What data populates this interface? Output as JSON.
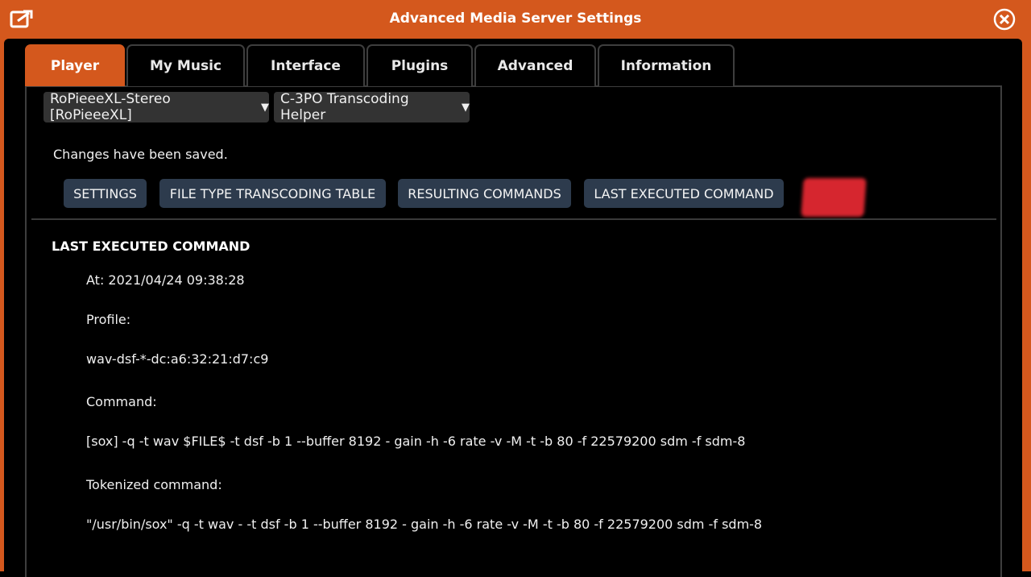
{
  "window": {
    "title": "Advanced Media Server Settings",
    "accent_color": "#d4581d",
    "popout_icon": "popout-icon",
    "close_icon": "close-icon"
  },
  "tabs": [
    {
      "label": "Player",
      "active": true
    },
    {
      "label": "My Music",
      "active": false
    },
    {
      "label": "Interface",
      "active": false
    },
    {
      "label": "Plugins",
      "active": false
    },
    {
      "label": "Advanced",
      "active": false
    },
    {
      "label": "Information",
      "active": false
    }
  ],
  "selectors": {
    "player": "RoPieeeXL-Stereo [RoPieeeXL]",
    "plugin": "C-3PO Transcoding Helper",
    "arrow": "▼"
  },
  "status_message": "Changes have been saved.",
  "subtabs": [
    {
      "label": "SETTINGS"
    },
    {
      "label": "FILE TYPE TRANSCODING TABLE"
    },
    {
      "label": "RESULTING COMMANDS"
    },
    {
      "label": "LAST EXECUTED COMMAND"
    }
  ],
  "last_command": {
    "heading": "LAST EXECUTED COMMAND",
    "at": "At: 2021/04/24 09:38:28",
    "profile_label": "Profile:",
    "profile_value": "wav-dsf-*-dc:a6:32:21:d7:c9",
    "command_label": "Command:",
    "command_value": "[sox] -q -t wav $FILE$ -t dsf -b 1 --buffer 8192 - gain -h -6 rate -v -M -t -b 80 -f 22579200 sdm -f sdm-8",
    "tokenized_label": "Tokenized command:",
    "tokenized_value": "\"/usr/bin/sox\" -q -t wav - -t dsf -b 1 --buffer 8192 - gain -h -6 rate -v -M -t -b 80 -f 22579200 sdm -f sdm-8"
  }
}
